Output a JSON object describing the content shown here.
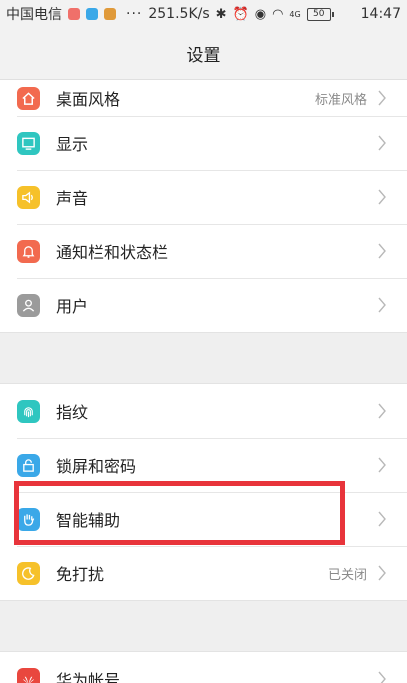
{
  "status_bar": {
    "carrier": "中国电信",
    "speed": "251.5K/s",
    "dots": "···",
    "network_label": "4G",
    "battery": "50",
    "time": "14:47"
  },
  "title": "设置",
  "groups": [
    [
      {
        "label": "桌面风格",
        "value": "标准风格",
        "icon": "home-icon",
        "color": "#f26a4f"
      },
      {
        "label": "显示",
        "value": "",
        "icon": "display-icon",
        "color": "#2fc6c0"
      },
      {
        "label": "声音",
        "value": "",
        "icon": "speaker-icon",
        "color": "#f6c12a"
      },
      {
        "label": "通知栏和状态栏",
        "value": "",
        "icon": "bell-icon",
        "color": "#f26a4f"
      },
      {
        "label": "用户",
        "value": "",
        "icon": "user-icon",
        "color": "#9b9b9b"
      }
    ],
    [
      {
        "label": "指纹",
        "value": "",
        "icon": "fingerprint-icon",
        "color": "#2fc6c0"
      },
      {
        "label": "锁屏和密码",
        "value": "",
        "icon": "lock-icon",
        "color": "#3aa8e8"
      },
      {
        "label": "智能辅助",
        "value": "",
        "icon": "hand-icon",
        "color": "#3aa8e8"
      },
      {
        "label": "免打扰",
        "value": "已关闭",
        "icon": "moon-icon",
        "color": "#f6c12a"
      }
    ],
    [
      {
        "label": "华为帐号",
        "value": "",
        "icon": "huawei-icon",
        "color": "#e9473e"
      }
    ]
  ],
  "highlight_color": "#e8343b"
}
